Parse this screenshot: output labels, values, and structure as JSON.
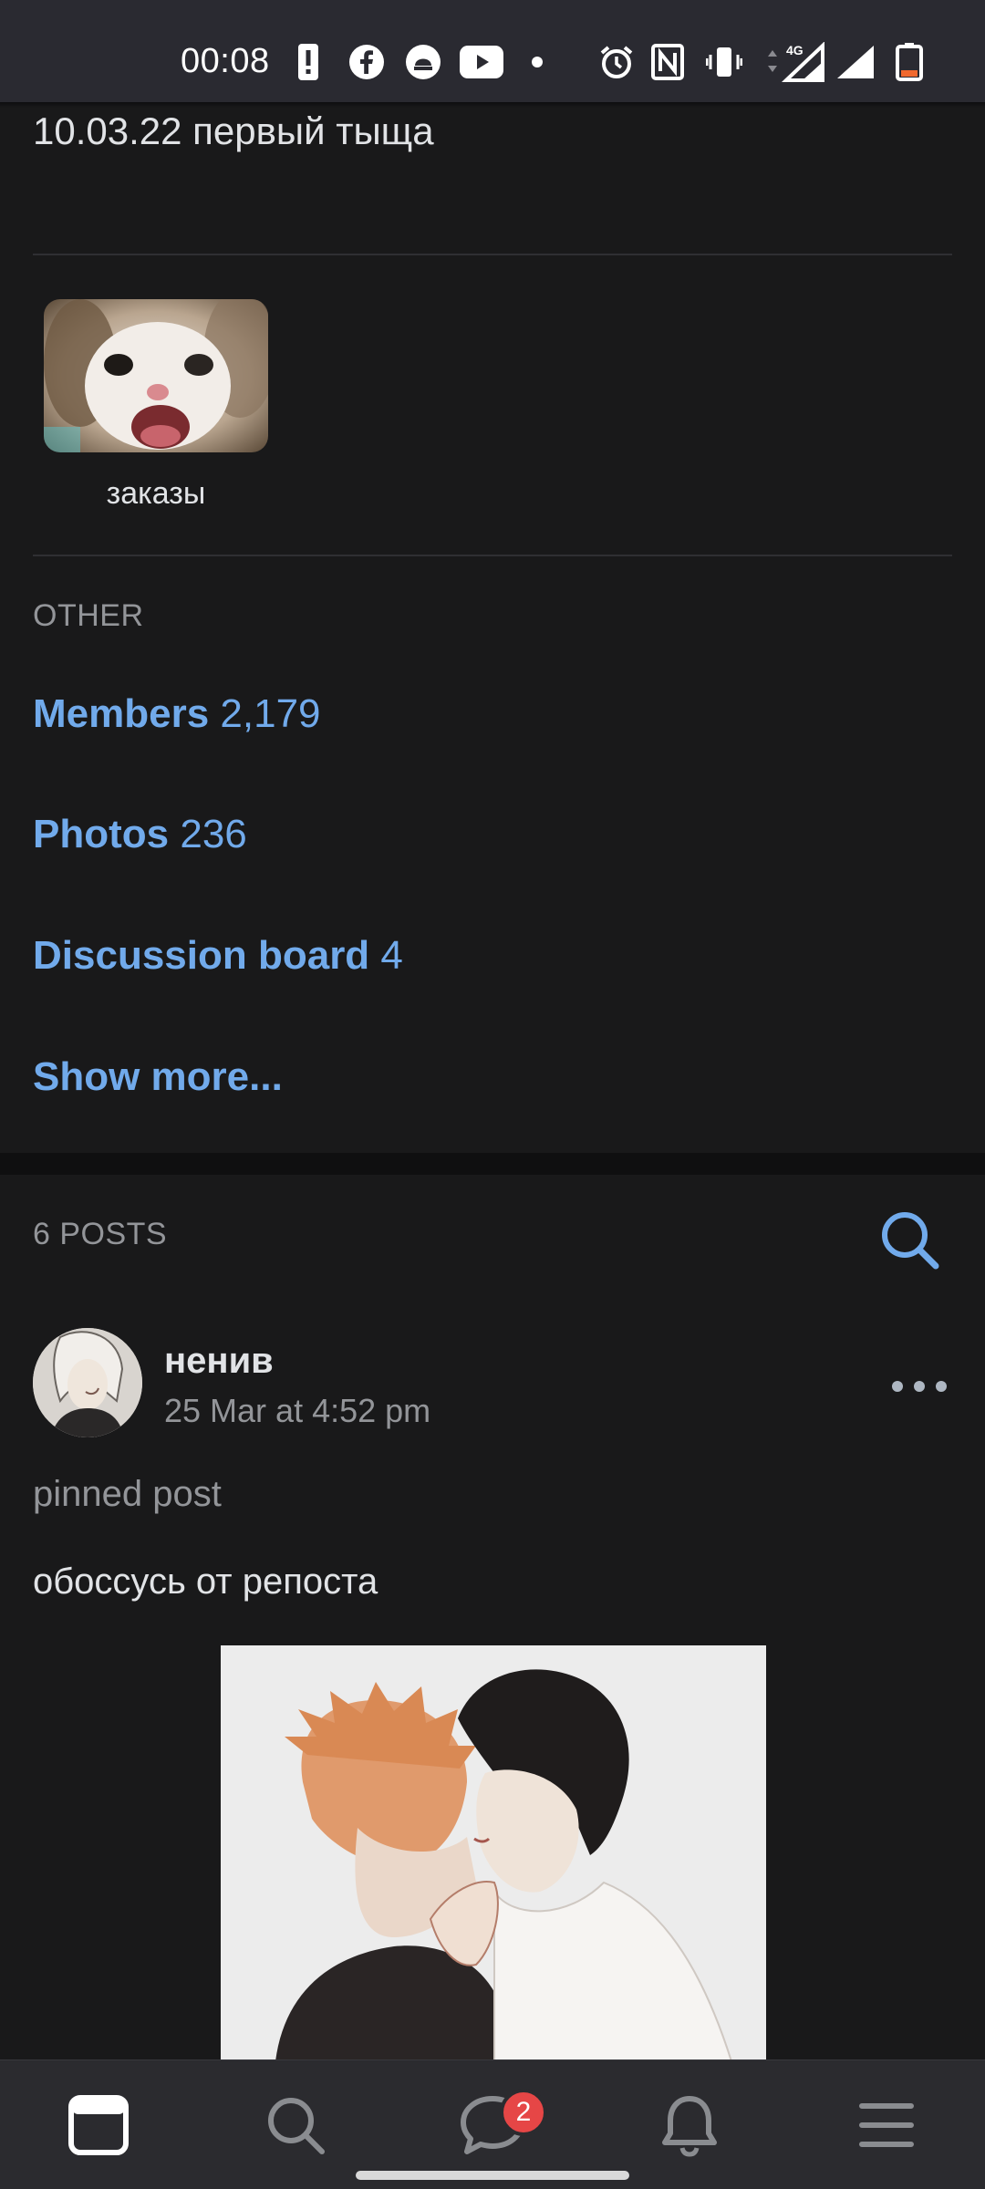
{
  "status_bar": {
    "time": "00:08",
    "icons": [
      "alert-icon",
      "facebook-icon",
      "vpn-icon",
      "youtube-icon",
      "dot-icon",
      "alarm-icon",
      "nfc-icon",
      "vibrate-icon",
      "signal-4g-icon",
      "signal-icon",
      "battery-low-icon"
    ],
    "network_label": "4G"
  },
  "group": {
    "description_line": "10.03.22 первый тыща",
    "album": {
      "label": "заказы"
    },
    "other": {
      "title": "OTHER",
      "links": [
        {
          "label": "Members",
          "count": "2,179"
        },
        {
          "label": "Photos",
          "count": "236"
        },
        {
          "label": "Discussion board",
          "count": "4"
        },
        {
          "label": "Show more...",
          "count": ""
        }
      ]
    }
  },
  "posts": {
    "title": "6 POSTS",
    "items": [
      {
        "author": "ненив",
        "date": "25 Mar at 4:52 pm",
        "pinned_label": "pinned post",
        "text": "обоссусь от репоста"
      }
    ]
  },
  "tabbar": {
    "tabs": [
      "feed-icon",
      "search-icon",
      "messages-icon",
      "notifications-icon",
      "menu-icon"
    ],
    "messages_badge": "2"
  },
  "colors": {
    "background": "#19191a",
    "accent": "#71aaeb",
    "secondary_text": "#939599",
    "badge": "#e64646"
  }
}
